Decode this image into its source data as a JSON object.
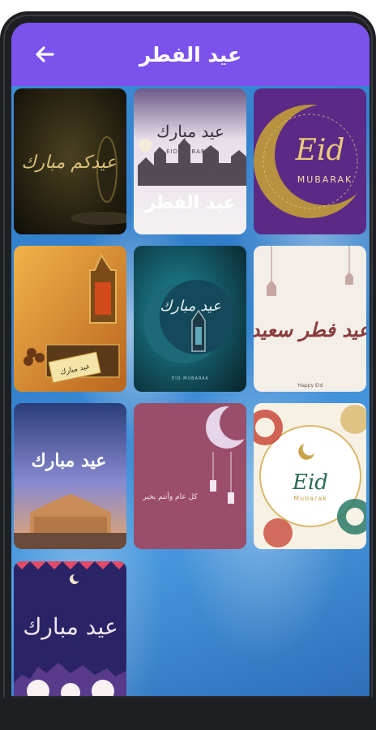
{
  "app_bar": {
    "title": "عيد الفطر",
    "back_icon": "arrow-left-icon",
    "color": "#7b52ec"
  },
  "cards": [
    {
      "id": "card-1",
      "texts": [
        "عيدكم مبارك"
      ],
      "theme": "dark-gold"
    },
    {
      "id": "card-2",
      "texts": [
        "عيد مبارك",
        "EID MUBARAK",
        "عيد الفطر"
      ],
      "theme": "light-purple"
    },
    {
      "id": "card-3",
      "texts": [
        "Eid",
        "MUBARAK"
      ],
      "theme": "purple-moon"
    },
    {
      "id": "card-4",
      "texts": [
        "عيد مبارك"
      ],
      "theme": "lantern-gold"
    },
    {
      "id": "card-5",
      "texts": [
        "عيد مبارك",
        "EID MUBARAK"
      ],
      "theme": "teal-moon"
    },
    {
      "id": "card-6",
      "texts": [
        "عيد فطر سعيد",
        "Happy Eid"
      ],
      "theme": "cream-calligraphy"
    },
    {
      "id": "card-7",
      "texts": [
        "عيد مبارك"
      ],
      "theme": "mosque-sunset"
    },
    {
      "id": "card-8",
      "texts": [
        "كل عام وأنتم بخير"
      ],
      "theme": "pink-moon"
    },
    {
      "id": "card-9",
      "texts": [
        "Eid",
        "Mubarak"
      ],
      "theme": "white-floral"
    },
    {
      "id": "card-10",
      "texts": [
        "عيد مبارك"
      ],
      "theme": "navy-cityscape"
    }
  ]
}
